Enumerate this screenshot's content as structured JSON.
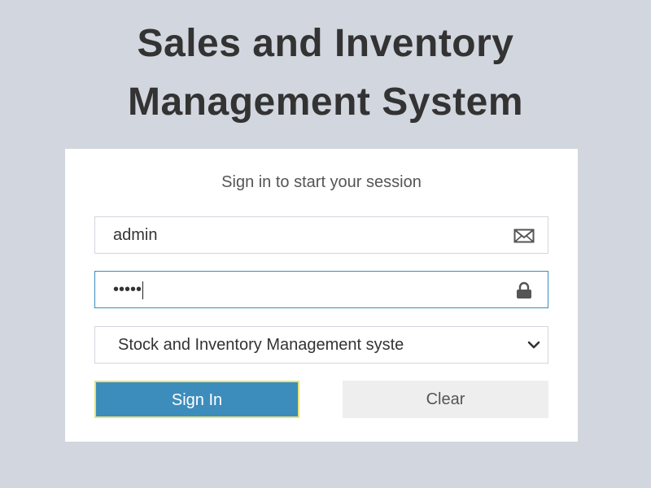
{
  "app": {
    "title_line1": "Sales and Inventory",
    "title_line2": "Management System"
  },
  "login": {
    "message": "Sign in to start your session",
    "username_value": "admin",
    "username_icon": "envelope-icon",
    "password_value": "•••••",
    "password_icon": "lock-icon",
    "system_select_value": "Stock and Inventory Management syste",
    "select_icon": "chevron-down-icon",
    "signin_label": "Sign In",
    "clear_label": "Clear"
  },
  "colors": {
    "background": "#d2d6de",
    "primary": "#3c8dbc",
    "focus_outline": "#e8e177",
    "secondary_button": "#eeeeee"
  }
}
